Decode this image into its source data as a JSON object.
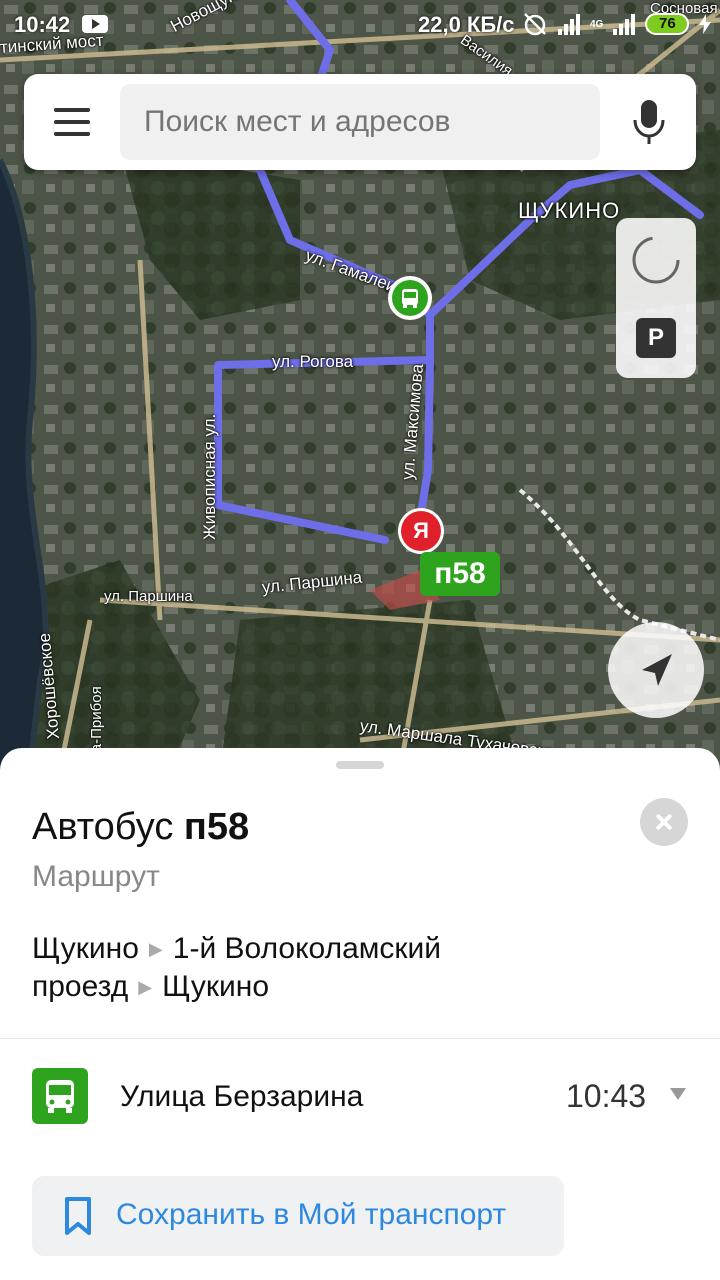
{
  "status_bar": {
    "time": "10:42",
    "net_speed": "22,0 КБ/с",
    "network_type": "4G",
    "battery": "76"
  },
  "search": {
    "placeholder": "Поиск мест и адресов"
  },
  "map": {
    "street_labels": {
      "gamalei": "ул. Гамалеи",
      "rogova": "ул. Рогова",
      "maksimova": "ул. Максимова",
      "zhivopisnaya": "Живописная ул.",
      "parshina_left": "ул. Паршина",
      "parshina": "ул. Паршина",
      "marshala": "ул. Маршала Тухачевского",
      "novoshchukinskaya": "Новощукинская",
      "most": "тинский мост",
      "horoshevskoe": "Хорошёвское",
      "pribo": "ва-Прибоя",
      "district": "ЩУКИНО",
      "sosnovaya": "Сосновая",
      "vasily": "Василия"
    },
    "route_badge": "п58",
    "parking_label": "P",
    "user_marker": "Я"
  },
  "sheet": {
    "title_prefix": "Автобус",
    "title_route": "п58",
    "subtitle": "Маршрут",
    "route_stops": [
      "Щукино",
      "1-й Волоколамский проезд",
      "Щукино"
    ],
    "stop": {
      "name": "Улица Берзарина",
      "time": "10:43"
    },
    "save_button": "Сохранить в Мой транспорт"
  },
  "colors": {
    "route": "#6e6ee8",
    "bus_green": "#2ea31e",
    "accent_blue": "#2d89e0",
    "marker_red": "#e0202a"
  }
}
